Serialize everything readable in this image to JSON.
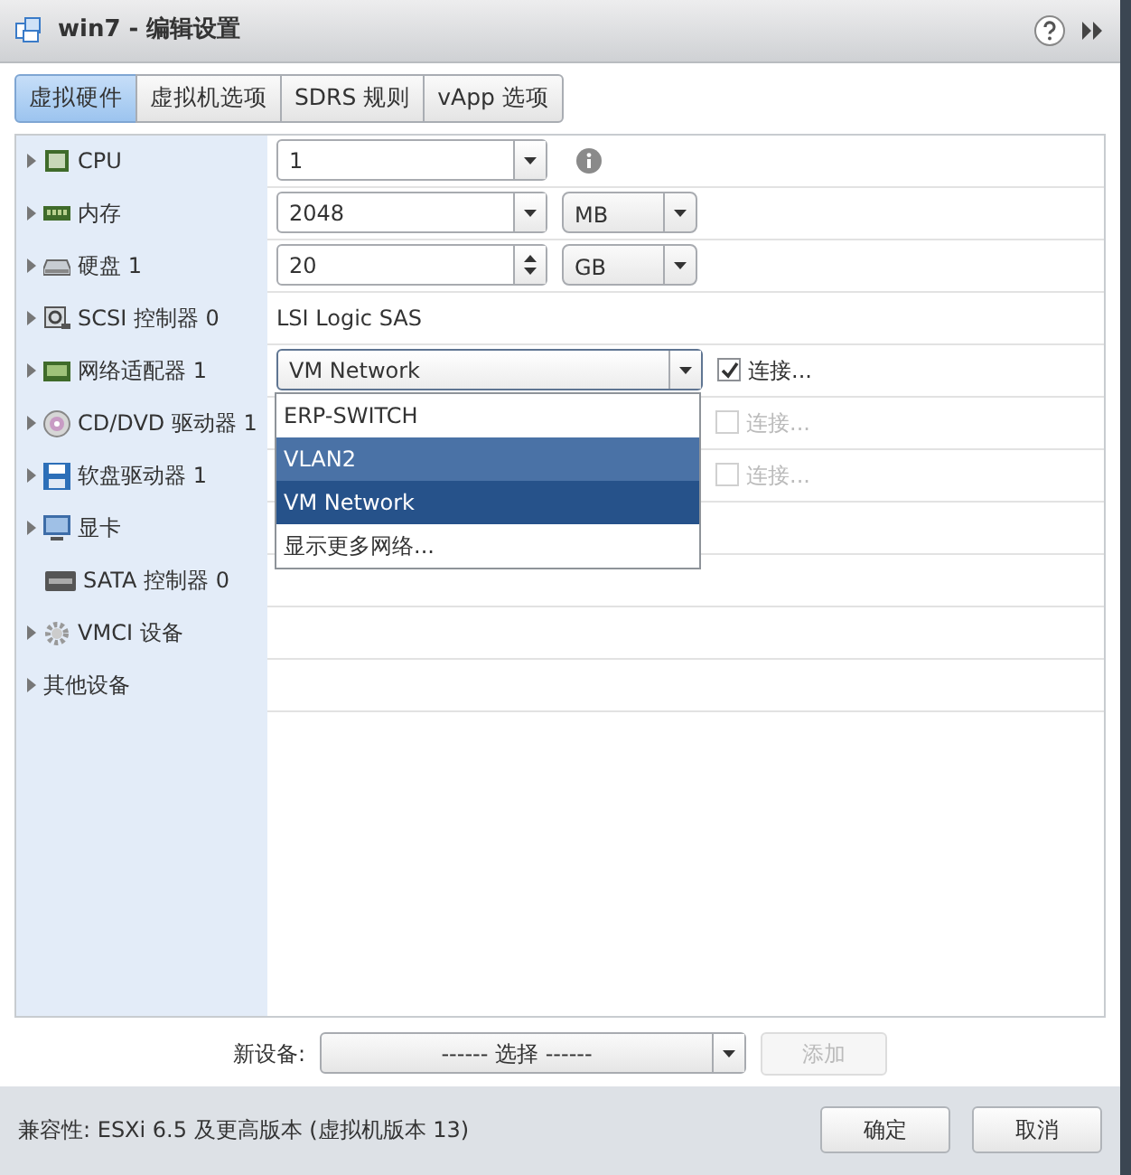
{
  "window": {
    "title": "win7 - 编辑设置"
  },
  "tabs": [
    {
      "label": "虚拟硬件",
      "selected": true
    },
    {
      "label": "虚拟机选项",
      "selected": false
    },
    {
      "label": "SDRS 规则",
      "selected": false
    },
    {
      "label": "vApp 选项",
      "selected": false
    }
  ],
  "devices": [
    {
      "kind": "cpu",
      "label": "CPU",
      "expandable": true,
      "control": {
        "kind": "combo",
        "value": "1",
        "info": true
      }
    },
    {
      "kind": "memory",
      "label": "内存",
      "expandable": true,
      "control": {
        "kind": "combo",
        "value": "2048",
        "unit": "MB"
      }
    },
    {
      "kind": "disk",
      "label": "硬盘 1",
      "expandable": true,
      "control": {
        "kind": "spin",
        "value": "20",
        "unit": "GB"
      }
    },
    {
      "kind": "scsi",
      "label": "SCSI 控制器 0",
      "expandable": true,
      "control": {
        "kind": "text",
        "value": "LSI Logic SAS"
      }
    },
    {
      "kind": "nic",
      "label": "网络适配器 1",
      "expandable": true,
      "control": {
        "kind": "network",
        "value": "VM Network",
        "expanded": true,
        "options": [
          {
            "label": "ERP-SWITCH",
            "selected": false,
            "hovered": false
          },
          {
            "label": "VLAN2",
            "selected": false,
            "hovered": true
          },
          {
            "label": "VM Network",
            "selected": true,
            "hovered": false
          },
          {
            "label": "显示更多网络...",
            "selected": false,
            "hovered": false
          }
        ],
        "connect": {
          "label": "连接...",
          "checked": true,
          "disabled": false
        }
      }
    },
    {
      "kind": "cdrom",
      "label": "CD/DVD 驱动器 1",
      "expandable": true,
      "control": {
        "kind": "connect",
        "connect": {
          "label": "连接...",
          "checked": false,
          "disabled": true
        }
      }
    },
    {
      "kind": "floppy",
      "label": "软盘驱动器 1",
      "expandable": true,
      "control": {
        "kind": "connect",
        "connect": {
          "label": "连接...",
          "checked": false,
          "disabled": true
        }
      }
    },
    {
      "kind": "display",
      "label": "显卡",
      "expandable": true
    },
    {
      "kind": "sata",
      "label": "SATA 控制器 0",
      "expandable": false
    },
    {
      "kind": "vmci",
      "label": "VMCI 设备",
      "expandable": true
    },
    {
      "kind": "other",
      "label": "其他设备",
      "expandable": true
    }
  ],
  "new_device": {
    "label": "新设备:",
    "select": "------ 选择 ------",
    "add_button": {
      "label": "添加",
      "disabled": true
    }
  },
  "footer": {
    "compatibility": "兼容性: ESXi 6.5 及更高版本 (虚拟机版本 13)",
    "buttons": [
      "确定",
      "取消"
    ]
  }
}
